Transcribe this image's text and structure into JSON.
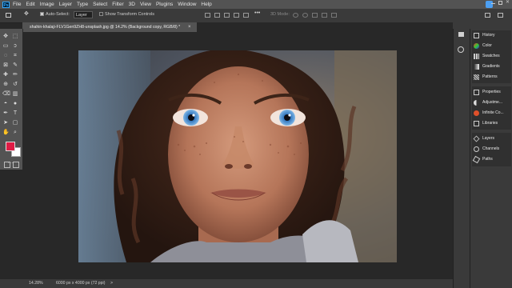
{
  "app": {
    "logo": "Ps"
  },
  "menu": [
    "File",
    "Edit",
    "Image",
    "Layer",
    "Type",
    "Select",
    "Filter",
    "3D",
    "View",
    "Plugins",
    "Window",
    "Help"
  ],
  "options_bar": {
    "auto_select_label": "Auto-Select:",
    "auto_select_target": "Layer",
    "show_transform_label": "Show Transform Controls",
    "mode_3d_label": "3D Mode:"
  },
  "document_tab": {
    "title": "shahin-khalaji-FLV1Gen9ZH8-unsplash.jpg @ 14.2% (Background copy, RGB/8) *",
    "close": "×"
  },
  "status_bar": {
    "zoom": "14.28%",
    "doc_size": "6000 px x 4000 px (72 ppi)",
    "arrow": ">"
  },
  "colors": {
    "foreground": "#e01c45",
    "background": "#ffffff",
    "accent": "#31a8ff"
  },
  "panels": {
    "group1": [
      "History",
      "Color",
      "Swatches",
      "Gradients",
      "Patterns"
    ],
    "group2": [
      "Properties",
      "Adjustme...",
      "Infinite Co...",
      "Libraries"
    ],
    "group3": [
      "Layers",
      "Channels",
      "Paths"
    ]
  },
  "tools": [
    "move-tool",
    "artboard-tool",
    "marquee-tool",
    "lasso-tool",
    "object-select-tool",
    "crop-tool",
    "frame-tool",
    "eyedropper-tool",
    "spot-heal-tool",
    "brush-tool",
    "clone-stamp-tool",
    "history-brush-tool",
    "eraser-tool",
    "gradient-tool",
    "blur-tool",
    "dodge-tool",
    "pen-tool",
    "type-tool",
    "path-select-tool",
    "rectangle-tool",
    "hand-tool",
    "zoom-tool",
    "more-tools"
  ]
}
